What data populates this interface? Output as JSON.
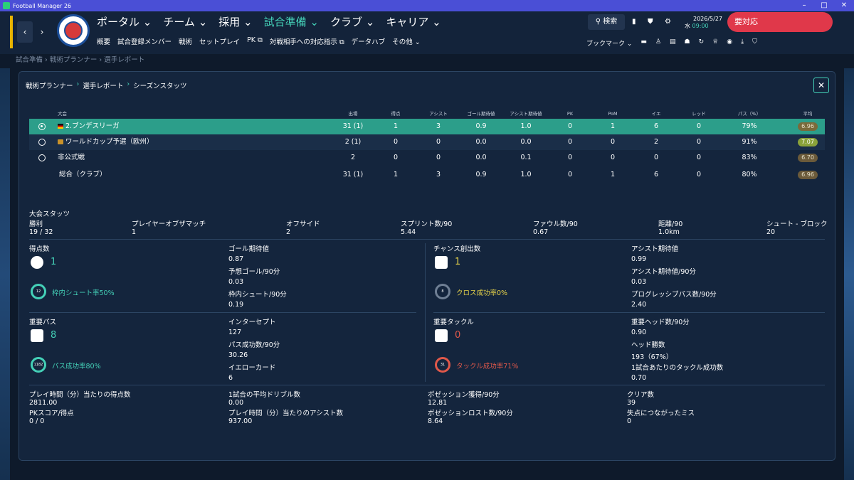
{
  "window": {
    "title": "Football Manager 26"
  },
  "nav": {
    "main": [
      "ポータル",
      "チーム",
      "採用",
      "試合準備",
      "クラブ",
      "キャリア"
    ],
    "active_index": 3,
    "sub": [
      "概要",
      "試合登録メンバー",
      "戦術",
      "セットプレイ",
      "PK",
      "対戦相手への対応指示",
      "データハブ",
      "その他"
    ]
  },
  "header": {
    "search_label": "検索",
    "date": "2026/5/27",
    "day": "水",
    "time": "09:00",
    "alert_label": "要対応",
    "bookmark_label": "ブックマーク"
  },
  "page_crumb": [
    "試合準備",
    "戦術プランナー",
    "選手レポート"
  ],
  "panel": {
    "crumb": [
      "戦術プランナー",
      "選手レポート",
      "シーズンスタッツ"
    ]
  },
  "table": {
    "headers": [
      "大会",
      "出場",
      "得点",
      "アシスト",
      "ゴール期待値",
      "アシスト期待値",
      "PK",
      "PoM",
      "イエ",
      "レッド",
      "パス（%）",
      "平均"
    ],
    "rows": [
      {
        "name": "2.ブンデスリーガ",
        "apps": "31 (1)",
        "goals": "1",
        "assists": "3",
        "xg": "0.9",
        "xa": "1.0",
        "pk": "0",
        "pom": "1",
        "yellow": "6",
        "red": "0",
        "pass": "79%",
        "avg": "6.96",
        "avg_color": "#7a6a3a"
      },
      {
        "name": "ワールドカップ予選（欧州）",
        "apps": "2 (1)",
        "goals": "0",
        "assists": "0",
        "xg": "0.0",
        "xa": "0.0",
        "pk": "0",
        "pom": "0",
        "yellow": "2",
        "red": "0",
        "pass": "91%",
        "avg": "7.07",
        "avg_color": "#8aa23a"
      },
      {
        "name": "非公式戦",
        "apps": "2",
        "goals": "0",
        "assists": "0",
        "xg": "0.0",
        "xa": "0.1",
        "pk": "0",
        "pom": "0",
        "yellow": "0",
        "red": "0",
        "pass": "83%",
        "avg": "6.70",
        "avg_color": "#6b5a3a"
      },
      {
        "name": "総合（クラブ）",
        "apps": "31 (1)",
        "goals": "1",
        "assists": "3",
        "xg": "0.9",
        "xa": "1.0",
        "pk": "0",
        "pom": "1",
        "yellow": "6",
        "red": "0",
        "pass": "80%",
        "avg": "6.96",
        "avg_color": "#6b5a3a"
      }
    ]
  },
  "comp_stats": {
    "title": "大会スタッツ",
    "items": [
      {
        "label": "勝利",
        "value": "19 / 32"
      },
      {
        "label": "プレイヤーオブザマッチ",
        "value": "1"
      },
      {
        "label": "オフサイド",
        "value": "2"
      },
      {
        "label": "スプリント数/90",
        "value": "5.44"
      },
      {
        "label": "ファウル数/90",
        "value": "0.67"
      },
      {
        "label": "距離/90",
        "value": "1.0km"
      },
      {
        "label": "シュート - ブロック",
        "value": "20"
      }
    ]
  },
  "goals": {
    "title": "得点数",
    "value": "1",
    "ring": "12",
    "ring_label": "枠内シュート率50%",
    "stats": [
      {
        "label": "ゴール期待値",
        "value": "0.87"
      },
      {
        "label": "予想ゴール/90分",
        "value": "0.03"
      },
      {
        "label": "枠内シュート/90分",
        "value": "0.19"
      }
    ]
  },
  "chances": {
    "title": "チャンス創出数",
    "value": "1",
    "ring": "8",
    "ring_label": "クロス成功率0%",
    "stats": [
      {
        "label": "アシスト期待値",
        "value": "0.99"
      },
      {
        "label": "アシスト期待値/90分",
        "value": "0.03"
      },
      {
        "label": "プログレッシブパス数/90分",
        "value": "2.40"
      }
    ]
  },
  "passes": {
    "title": "重要パス",
    "value": "8",
    "ring": "1182",
    "ring_label": "パス成功率80%",
    "stats": [
      {
        "label": "インターセプト",
        "value": "127"
      },
      {
        "label": "パス成功数/90分",
        "value": "30.26"
      },
      {
        "label": "イエローカード",
        "value": "6"
      }
    ]
  },
  "tackles": {
    "title": "重要タックル",
    "value": "0",
    "ring": "31",
    "ring_label": "タックル成功率71%",
    "stats": [
      {
        "label": "重要ヘッド数/90分",
        "value": "0.90"
      },
      {
        "label": "ヘッド勝数",
        "value": "193（67%）"
      },
      {
        "label": "1試合あたりのタックル成功数",
        "value": "0.70"
      }
    ]
  },
  "bottom": [
    {
      "label": "プレイ時間（分）当たりの得点数",
      "value": "2811.00"
    },
    {
      "label": "1試合の平均ドリブル数",
      "value": "0.00"
    },
    {
      "label": "ポゼッション獲得/90分",
      "value": "12.81"
    },
    {
      "label": "クリア数",
      "value": "39"
    },
    {
      "label": "PKスコア/得点",
      "value": "0 / 0"
    },
    {
      "label": "プレイ時間（分）当たりのアシスト数",
      "value": "937.00"
    },
    {
      "label": "ポゼッションロスト数/90分",
      "value": "8.64"
    },
    {
      "label": "失点につながったミス",
      "value": "0"
    }
  ],
  "colors": {
    "accent": "#44d0b7",
    "yellow": "#e8d44a",
    "red": "#e0584a",
    "selected_row": "#2c9e8a"
  }
}
